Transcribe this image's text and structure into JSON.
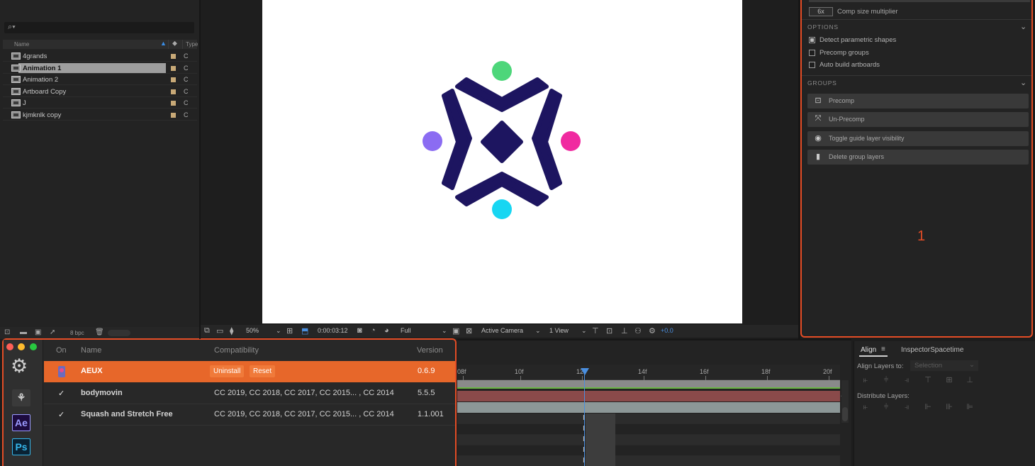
{
  "project_panel": {
    "search_glyph": "⌕▾",
    "columns": {
      "name": "Name",
      "type": "Type"
    },
    "items": [
      {
        "name": "4grands",
        "type": "C",
        "selected": false
      },
      {
        "name": "Animation 1",
        "type": "C",
        "selected": true
      },
      {
        "name": "Animation 2",
        "type": "C",
        "selected": false
      },
      {
        "name": "Artboard Copy",
        "type": "C",
        "selected": false
      },
      {
        "name": "J",
        "type": "C",
        "selected": false
      },
      {
        "name": "kjmknlk copy",
        "type": "C",
        "selected": false
      }
    ],
    "footer": {
      "bpc": "8 bpc"
    }
  },
  "viewer": {
    "toolbar": {
      "zoom": "50%",
      "timecode": "0:00:03:12",
      "resolution": "Full",
      "camera": "Active Camera",
      "views": "1 View",
      "exposure": "+0.0"
    },
    "logo_colors": {
      "navy": "#1d1560",
      "green": "#4dd67a",
      "purple": "#8b6cf2",
      "pink": "#f02aa0",
      "cyan": "#18d6f2"
    }
  },
  "aeux_panel": {
    "multiplier_value": "6x",
    "multiplier_label": "Comp size multiplier",
    "options_title": "OPTIONS",
    "options": [
      {
        "label": "Detect parametric shapes",
        "checked": true
      },
      {
        "label": "Precomp groups",
        "checked": false
      },
      {
        "label": "Auto build artboards",
        "checked": false
      }
    ],
    "groups_title": "GROUPS",
    "group_buttons": [
      {
        "label": "Precomp",
        "icon": "precomp-icon"
      },
      {
        "label": "Un-Precomp",
        "icon": "expand-icon"
      },
      {
        "label": "Toggle guide layer visibility",
        "icon": "eye-slash-icon"
      },
      {
        "label": "Delete group layers",
        "icon": "trash-icon"
      }
    ],
    "marker": "1"
  },
  "extension_manager": {
    "columns": {
      "on": "On",
      "name": "Name",
      "compat": "Compatibility",
      "version": "Version"
    },
    "rows": [
      {
        "name": "AEUX",
        "compat": "",
        "version": "0.6.9",
        "on": "",
        "active": true,
        "uninstall": "Uninstall",
        "reset": "Reset"
      },
      {
        "name": "bodymovin",
        "compat": "CC 2019, CC 2018, CC 2017, CC 2015... , CC 2014",
        "version": "5.5.5",
        "on": "✓",
        "active": false
      },
      {
        "name": "Squash and Stretch Free",
        "compat": "CC 2019, CC 2018, CC 2017, CC 2015... , CC 2014",
        "version": "1.1.001",
        "on": "✓",
        "active": false
      }
    ],
    "sidebar_apps": [
      {
        "label": "Ae",
        "color": "#9b9bff",
        "bg": "#1d0b3f"
      },
      {
        "label": "Ps",
        "color": "#35b6ea",
        "bg": "#0a2233"
      }
    ],
    "accent": "#e7672a"
  },
  "timeline": {
    "ticks": [
      "08f",
      "10f",
      "12f",
      "14f",
      "16f",
      "18f",
      "20f"
    ],
    "playhead_color": "#4a8fe0"
  },
  "align_panel": {
    "tab_align": "Align",
    "tab_menu": "≡",
    "tab_inspector": "InspectorSpacetime",
    "align_to_label": "Align Layers to:",
    "align_to_value": "Selection",
    "distribute_label": "Distribute Layers:"
  }
}
